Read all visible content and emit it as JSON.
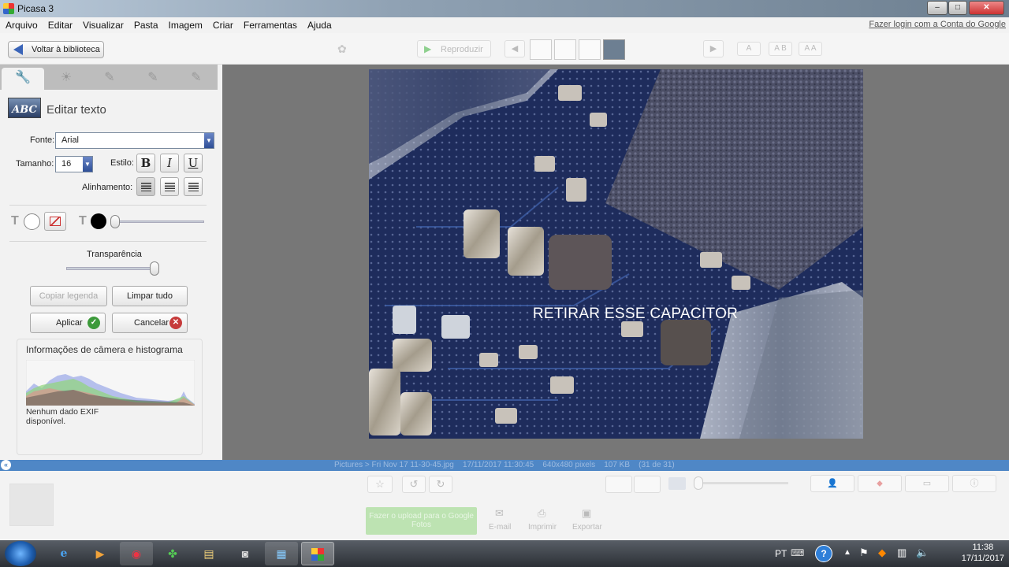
{
  "window": {
    "title": "Picasa 3",
    "minimize": "–",
    "maximize": "□",
    "close": "✕"
  },
  "menu": {
    "items": [
      "Arquivo",
      "Editar",
      "Visualizar",
      "Pasta",
      "Imagem",
      "Criar",
      "Ferramentas",
      "Ajuda"
    ],
    "login_link": "Fazer login com a Conta do Google"
  },
  "toolbar": {
    "back_label": "Voltar à biblioteca",
    "play_label": "Reproduzir",
    "text_modes": [
      "A",
      "A B",
      "A A"
    ]
  },
  "edit_text_panel": {
    "title": "Editar texto",
    "font_label": "Fonte:",
    "font_value": "Arial",
    "size_label": "Tamanho:",
    "size_value": "16",
    "style_label": "Estilo:",
    "bold": "B",
    "italic": "I",
    "underline": "U",
    "align_label": "Alinhamento:",
    "text_color": "#ffffff",
    "outline_color": "#000000",
    "transparency_label": "Transparência",
    "transparency_value": 1.0,
    "copy_caption": "Copiar legenda",
    "clear_all": "Limpar tudo",
    "apply": "Aplicar",
    "cancel": "Cancelar"
  },
  "info": {
    "title": "Informações de câmera e histograma",
    "exif": "Nenhum dado EXIF disponível."
  },
  "photo": {
    "caption": "RETIRAR ESSE CAPACITOR"
  },
  "statusbar": {
    "path": "Pictures > Fri Nov 17 11-30-45.jpg",
    "date": "17/11/2017 11:30:45",
    "dims": "640x480 pixels",
    "size": "107 KB",
    "count": "(31 de 31)"
  },
  "bottom": {
    "upload": "Fazer o upload para o Google Fotos",
    "email": "E-mail",
    "print": "Imprimir",
    "export": "Exportar"
  },
  "taskbar": {
    "lang": "PT",
    "time": "11:38",
    "date": "17/11/2017"
  },
  "colors": {
    "status_blue": "#4f87c6",
    "accent_green": "#3c9a3a",
    "cancel_red": "#c63b3b"
  }
}
